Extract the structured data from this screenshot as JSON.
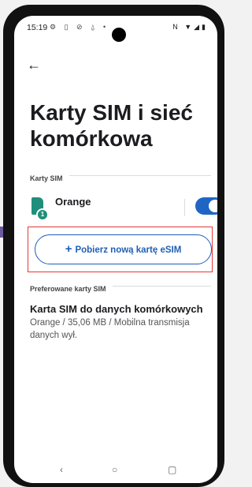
{
  "status_bar": {
    "time": "15:19",
    "left_icons": "⚙ ▯ ⊘ ⍙ •",
    "right_icons": "N ▼◢▮"
  },
  "page_title": "Karty SIM i sieć komórkowa",
  "sim_section": {
    "label": "Karty SIM",
    "sim": {
      "name": "Orange",
      "badge": "1",
      "enabled": true
    }
  },
  "esim_button": {
    "label": "Pobierz nową kartę eSIM",
    "icon": "plus-icon"
  },
  "preferred_section": {
    "label": "Preferowane karty SIM",
    "item": {
      "title": "Karta SIM do danych komórkowych",
      "subtitle": "Orange / 35,06 MB / Mobilna transmisja danych wył."
    }
  },
  "colors": {
    "accent": "#1f5fb5",
    "sim": "#1e8f7a",
    "highlight": "#e53935"
  },
  "nav": {
    "back": "‹",
    "home": "○",
    "recents": "▢"
  }
}
